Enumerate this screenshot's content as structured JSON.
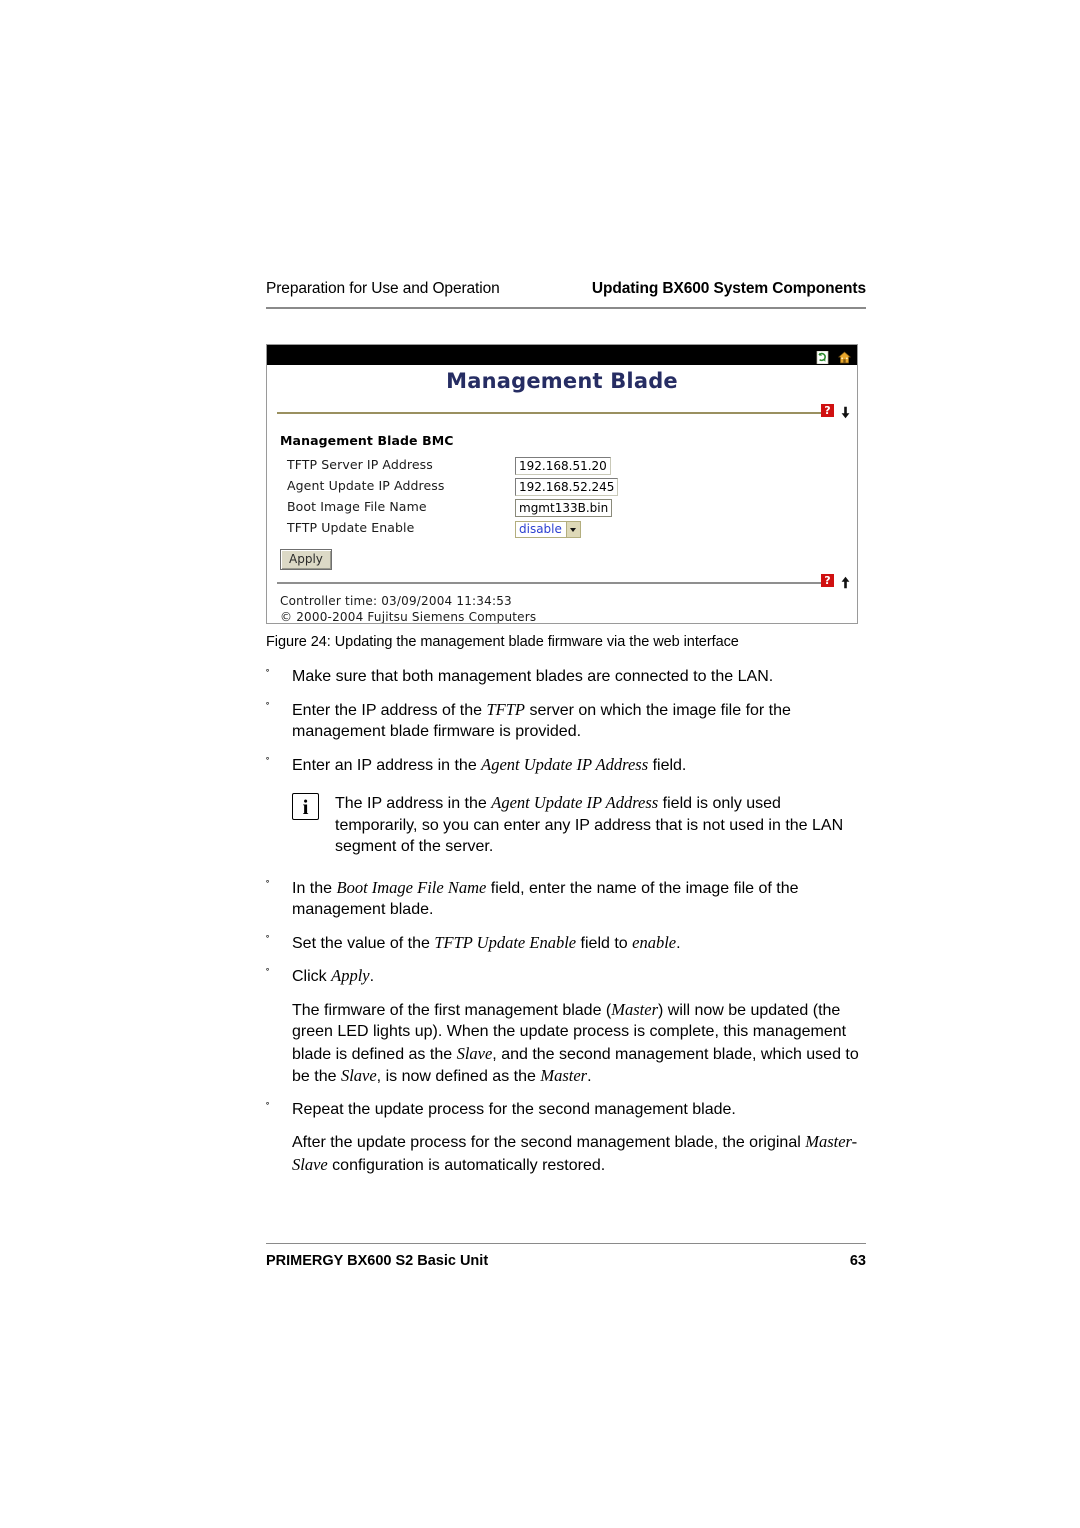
{
  "header": {
    "left": "Preparation for Use and Operation",
    "right": "Updating BX600 System Components"
  },
  "screenshot": {
    "titlebar_icons": [
      "refresh-icon",
      "home-icon"
    ],
    "title": "Management Blade",
    "help_icon_label": "?",
    "section_title": "Management Blade BMC",
    "fields": [
      {
        "label": "TFTP Server IP Address",
        "value": "192.168.51.20"
      },
      {
        "label": "Agent Update IP Address",
        "value": "192.168.52.245"
      },
      {
        "label": "Boot Image File Name",
        "value": "mgmt133B.bin"
      },
      {
        "label": "TFTP Update Enable",
        "value": "disable"
      }
    ],
    "apply_label": "Apply",
    "footer_line1": "Controller time: 03/09/2004 11:34:53",
    "footer_line2": "© 2000-2004 Fujitsu Siemens Computers"
  },
  "figure": {
    "caption": "Figure 24: Updating the management blade firmware via the web interface"
  },
  "body": {
    "bullet_mark": "˚",
    "b1": "Make sure that both management blades are connected to the LAN.",
    "b2_a": "Enter the IP address of the ",
    "b2_i": "TFTP",
    "b2_b": " server on which the image file for the management blade firmware is provided.",
    "b3_a": "Enter an IP address in the ",
    "b3_i": "Agent Update IP Address",
    "b3_b": " field.",
    "note_a": "The IP address in the ",
    "note_i": "Agent Update IP Address",
    "note_b": " field is only used temporarily, so you can enter any IP address that is not used in the LAN segment of the server.",
    "note_icon_char": "i",
    "b4_a": "In the ",
    "b4_i": "Boot Image File Name",
    "b4_b": " field, enter the name of the image file of the management blade.",
    "b5_a": "Set the value of the ",
    "b5_i": "TFTP Update Enable",
    "b5_b": " field to ",
    "b5_i2": "enable",
    "b5_c": ".",
    "b6_a": "Click ",
    "b6_i": "Apply",
    "b6_b": ".",
    "p1_a": "The firmware of the first management blade (",
    "p1_i1": "Master",
    "p1_b": ") will now be updated (the green LED lights up). When the update process is complete, this management blade is defined as the ",
    "p1_i2": "Slave",
    "p1_c": ", and the second management blade, which used to be the ",
    "p1_i3": "Slave",
    "p1_d": ", is now defined as the ",
    "p1_i4": "Master",
    "p1_e": ".",
    "b7": "Repeat the update process for the second management blade.",
    "p2_a": "After the update process for the second management blade, the original ",
    "p2_i": "Master-Slave",
    "p2_b": " configuration is automatically restored."
  },
  "footer": {
    "doc_title": "PRIMERGY BX600 S2 Basic Unit",
    "page_number": "63"
  },
  "colors": {
    "title_blue": "#262d63",
    "rule_olive": "#9a9060",
    "help_red": "#d01010",
    "select_text_blue": "#2b3fd0"
  }
}
